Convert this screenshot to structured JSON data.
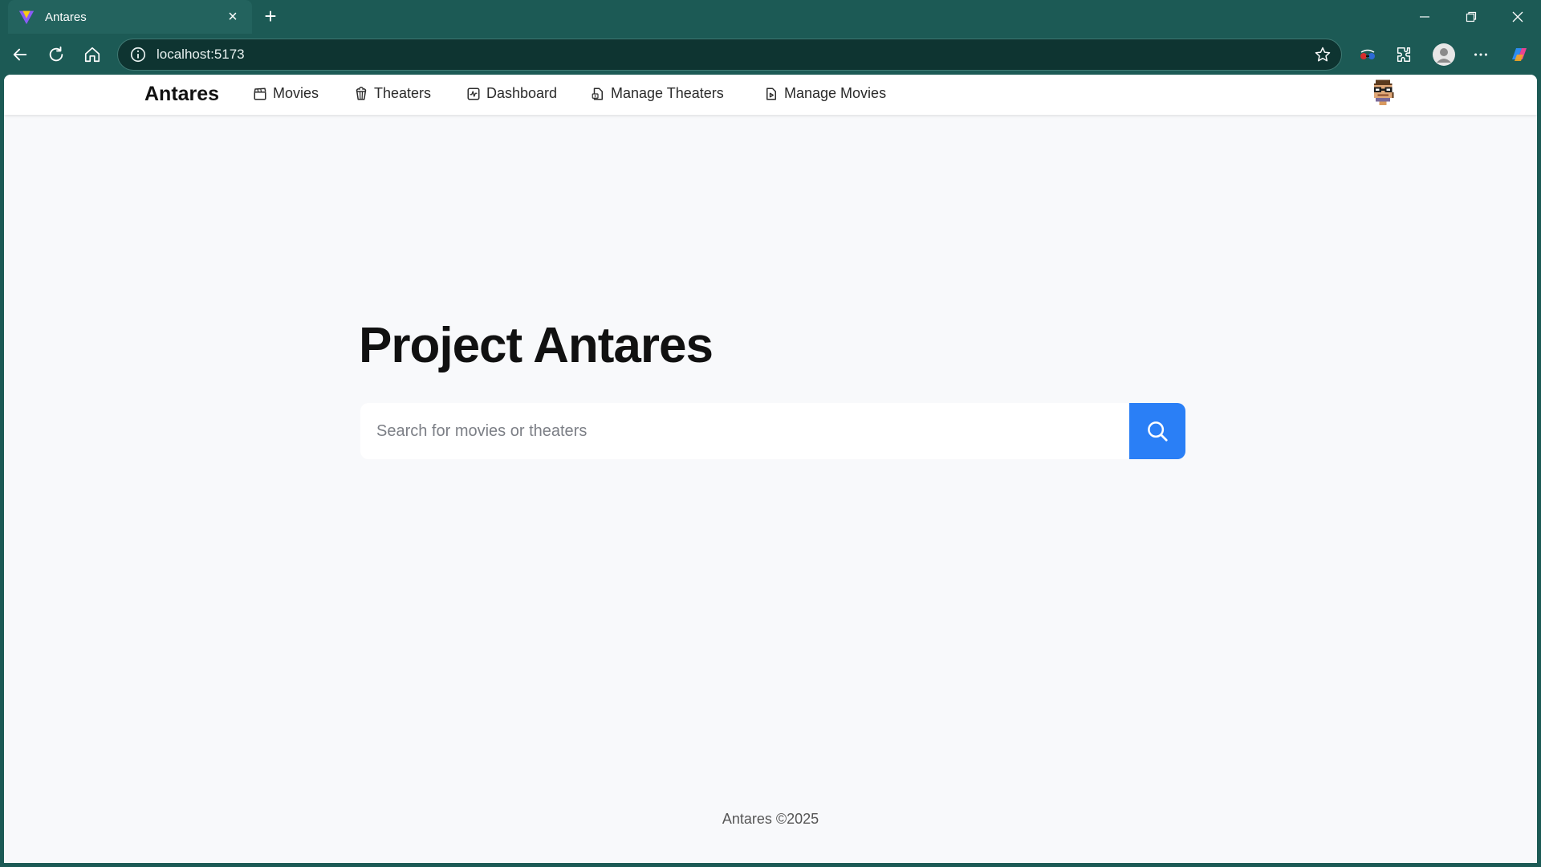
{
  "browser": {
    "tab_title": "Antares",
    "url": "localhost:5173"
  },
  "navbar": {
    "brand": "Antares",
    "items": [
      {
        "label": "Movies",
        "icon": "clapperboard-icon"
      },
      {
        "label": "Theaters",
        "icon": "popcorn-icon"
      },
      {
        "label": "Dashboard",
        "icon": "activity-icon"
      },
      {
        "label": "Manage Theaters",
        "icon": "file-settings-icon"
      },
      {
        "label": "Manage Movies",
        "icon": "file-video-icon"
      }
    ]
  },
  "main": {
    "title": "Project Antares",
    "search": {
      "placeholder": "Search for movies or theaters",
      "value": ""
    }
  },
  "footer": {
    "text": "Antares ©2025"
  },
  "colors": {
    "chrome": "#1c5a55",
    "page_bg": "#f8f9fb",
    "accent": "#2a7ff6"
  }
}
